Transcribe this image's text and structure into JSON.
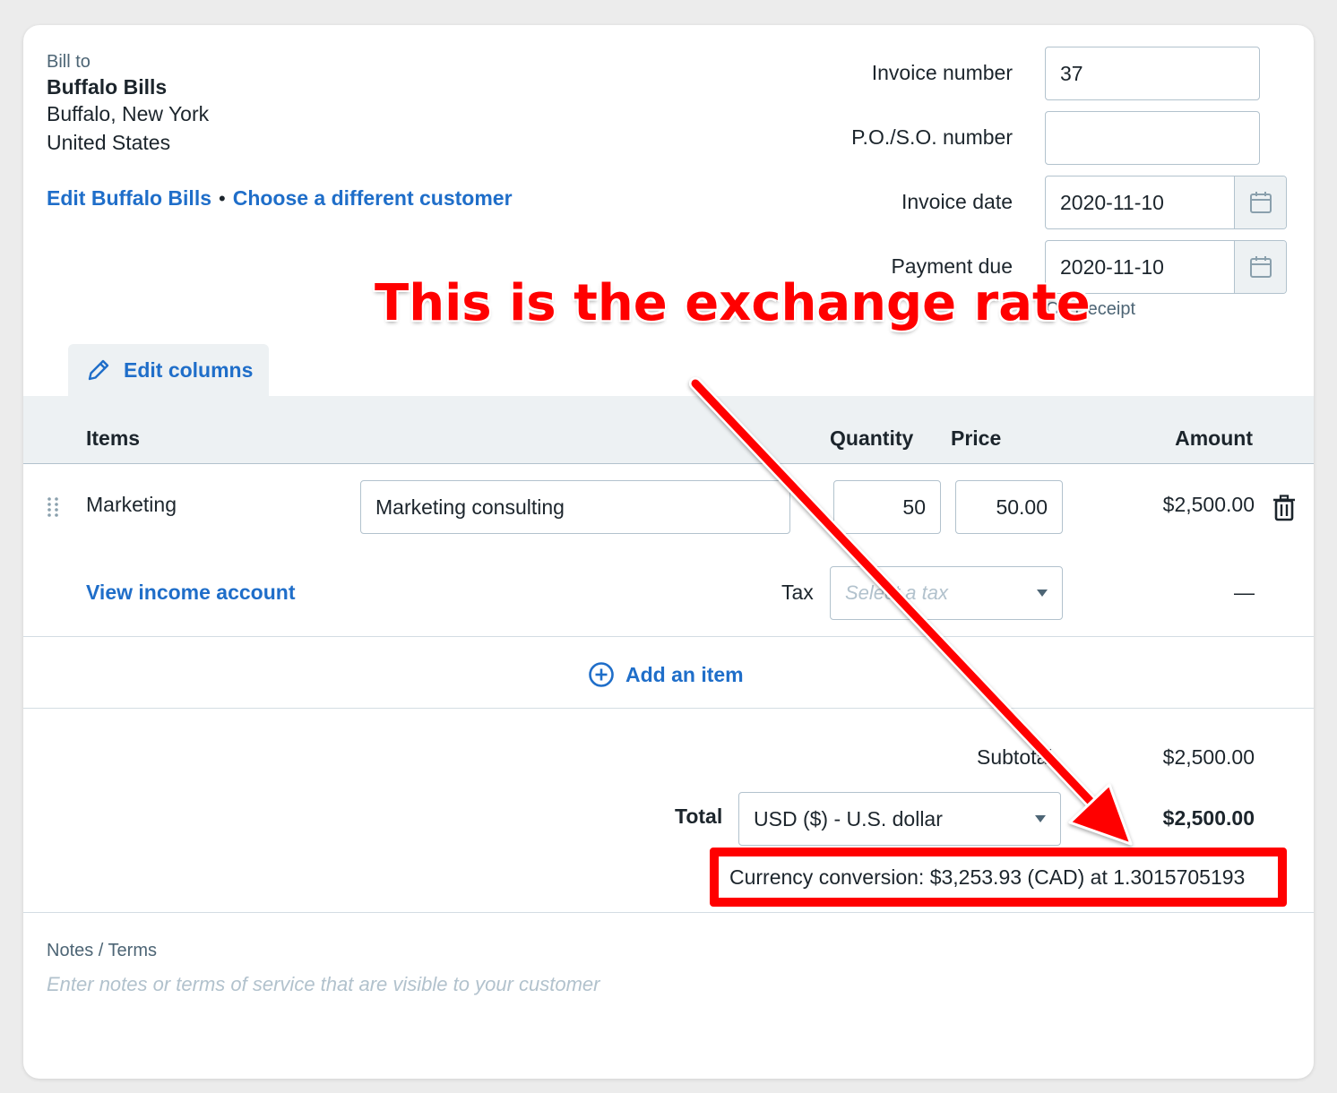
{
  "bill_to": {
    "label": "Bill to",
    "name": "Buffalo Bills",
    "line1": "Buffalo, New York",
    "line2": "United States",
    "edit_link": "Edit Buffalo Bills",
    "separator": "•",
    "choose_link": "Choose a different customer"
  },
  "invoice_fields": {
    "invoice_number_label": "Invoice number",
    "invoice_number_value": "37",
    "po_label": "P.O./S.O. number",
    "po_value": "",
    "invoice_date_label": "Invoice date",
    "invoice_date_value": "2020-11-10",
    "payment_due_label": "Payment due",
    "payment_due_value": "2020-11-10",
    "payment_due_hint": "On Receipt"
  },
  "edit_columns_label": "Edit columns",
  "table": {
    "headers": {
      "items": "Items",
      "quantity": "Quantity",
      "price": "Price",
      "amount": "Amount"
    },
    "rows": [
      {
        "item": "Marketing",
        "description": "Marketing consulting",
        "quantity": "50",
        "price": "50.00",
        "amount": "$2,500.00",
        "view_account_link": "View income account",
        "tax_label": "Tax",
        "tax_placeholder": "Select a tax",
        "tax_amount": "—"
      }
    ]
  },
  "add_item_label": "Add an item",
  "totals": {
    "subtotal_label": "Subtotal",
    "subtotal_value": "$2,500.00",
    "total_label": "Total",
    "currency": "USD ($) - U.S. dollar",
    "total_value": "$2,500.00",
    "conversion": "Currency conversion: $3,253.93 (CAD) at 1.3015705193"
  },
  "notes": {
    "label": "Notes / Terms",
    "placeholder": "Enter notes or terms of service that are visible to your customer"
  },
  "annotation": {
    "text": "This is the exchange rate",
    "color": "#ff0000"
  },
  "colors": {
    "link": "#1f6ec9",
    "header_bg": "#edf1f3",
    "border": "#b2c2cd"
  }
}
